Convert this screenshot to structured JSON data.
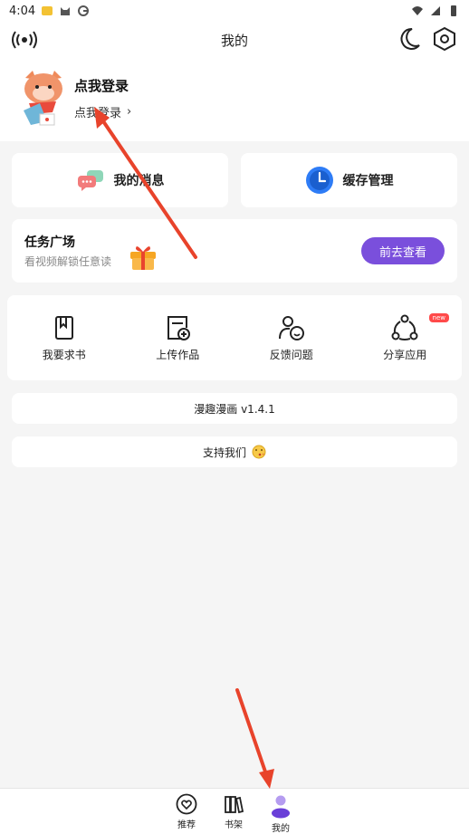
{
  "status_bar": {
    "time": "4:04"
  },
  "header": {
    "title": "我的"
  },
  "profile": {
    "title": "点我登录",
    "subtitle": "点我登录",
    "chevron": "›"
  },
  "quick_cards": {
    "messages": {
      "label": "我的消息"
    },
    "cache": {
      "label": "缓存管理"
    }
  },
  "task": {
    "title": "任务广场",
    "subtitle": "看视频解锁任意读",
    "button": "前去查看"
  },
  "actions": [
    {
      "label": "我要求书",
      "icon": "book-icon"
    },
    {
      "label": "上传作品",
      "icon": "upload-icon"
    },
    {
      "label": "反馈问题",
      "icon": "feedback-icon"
    },
    {
      "label": "分享应用",
      "icon": "share-icon",
      "badge": "new"
    }
  ],
  "version": {
    "text": "漫趣漫画 v1.4.1"
  },
  "support": {
    "text": "支持我们"
  },
  "bottom_nav": [
    {
      "label": "推荐"
    },
    {
      "label": "书架"
    },
    {
      "label": "我的"
    }
  ],
  "colors": {
    "accent": "#7a4fdc",
    "arrow": "#e8432b",
    "badge": "#ff4a4a",
    "clock": "#2e7cf6"
  }
}
